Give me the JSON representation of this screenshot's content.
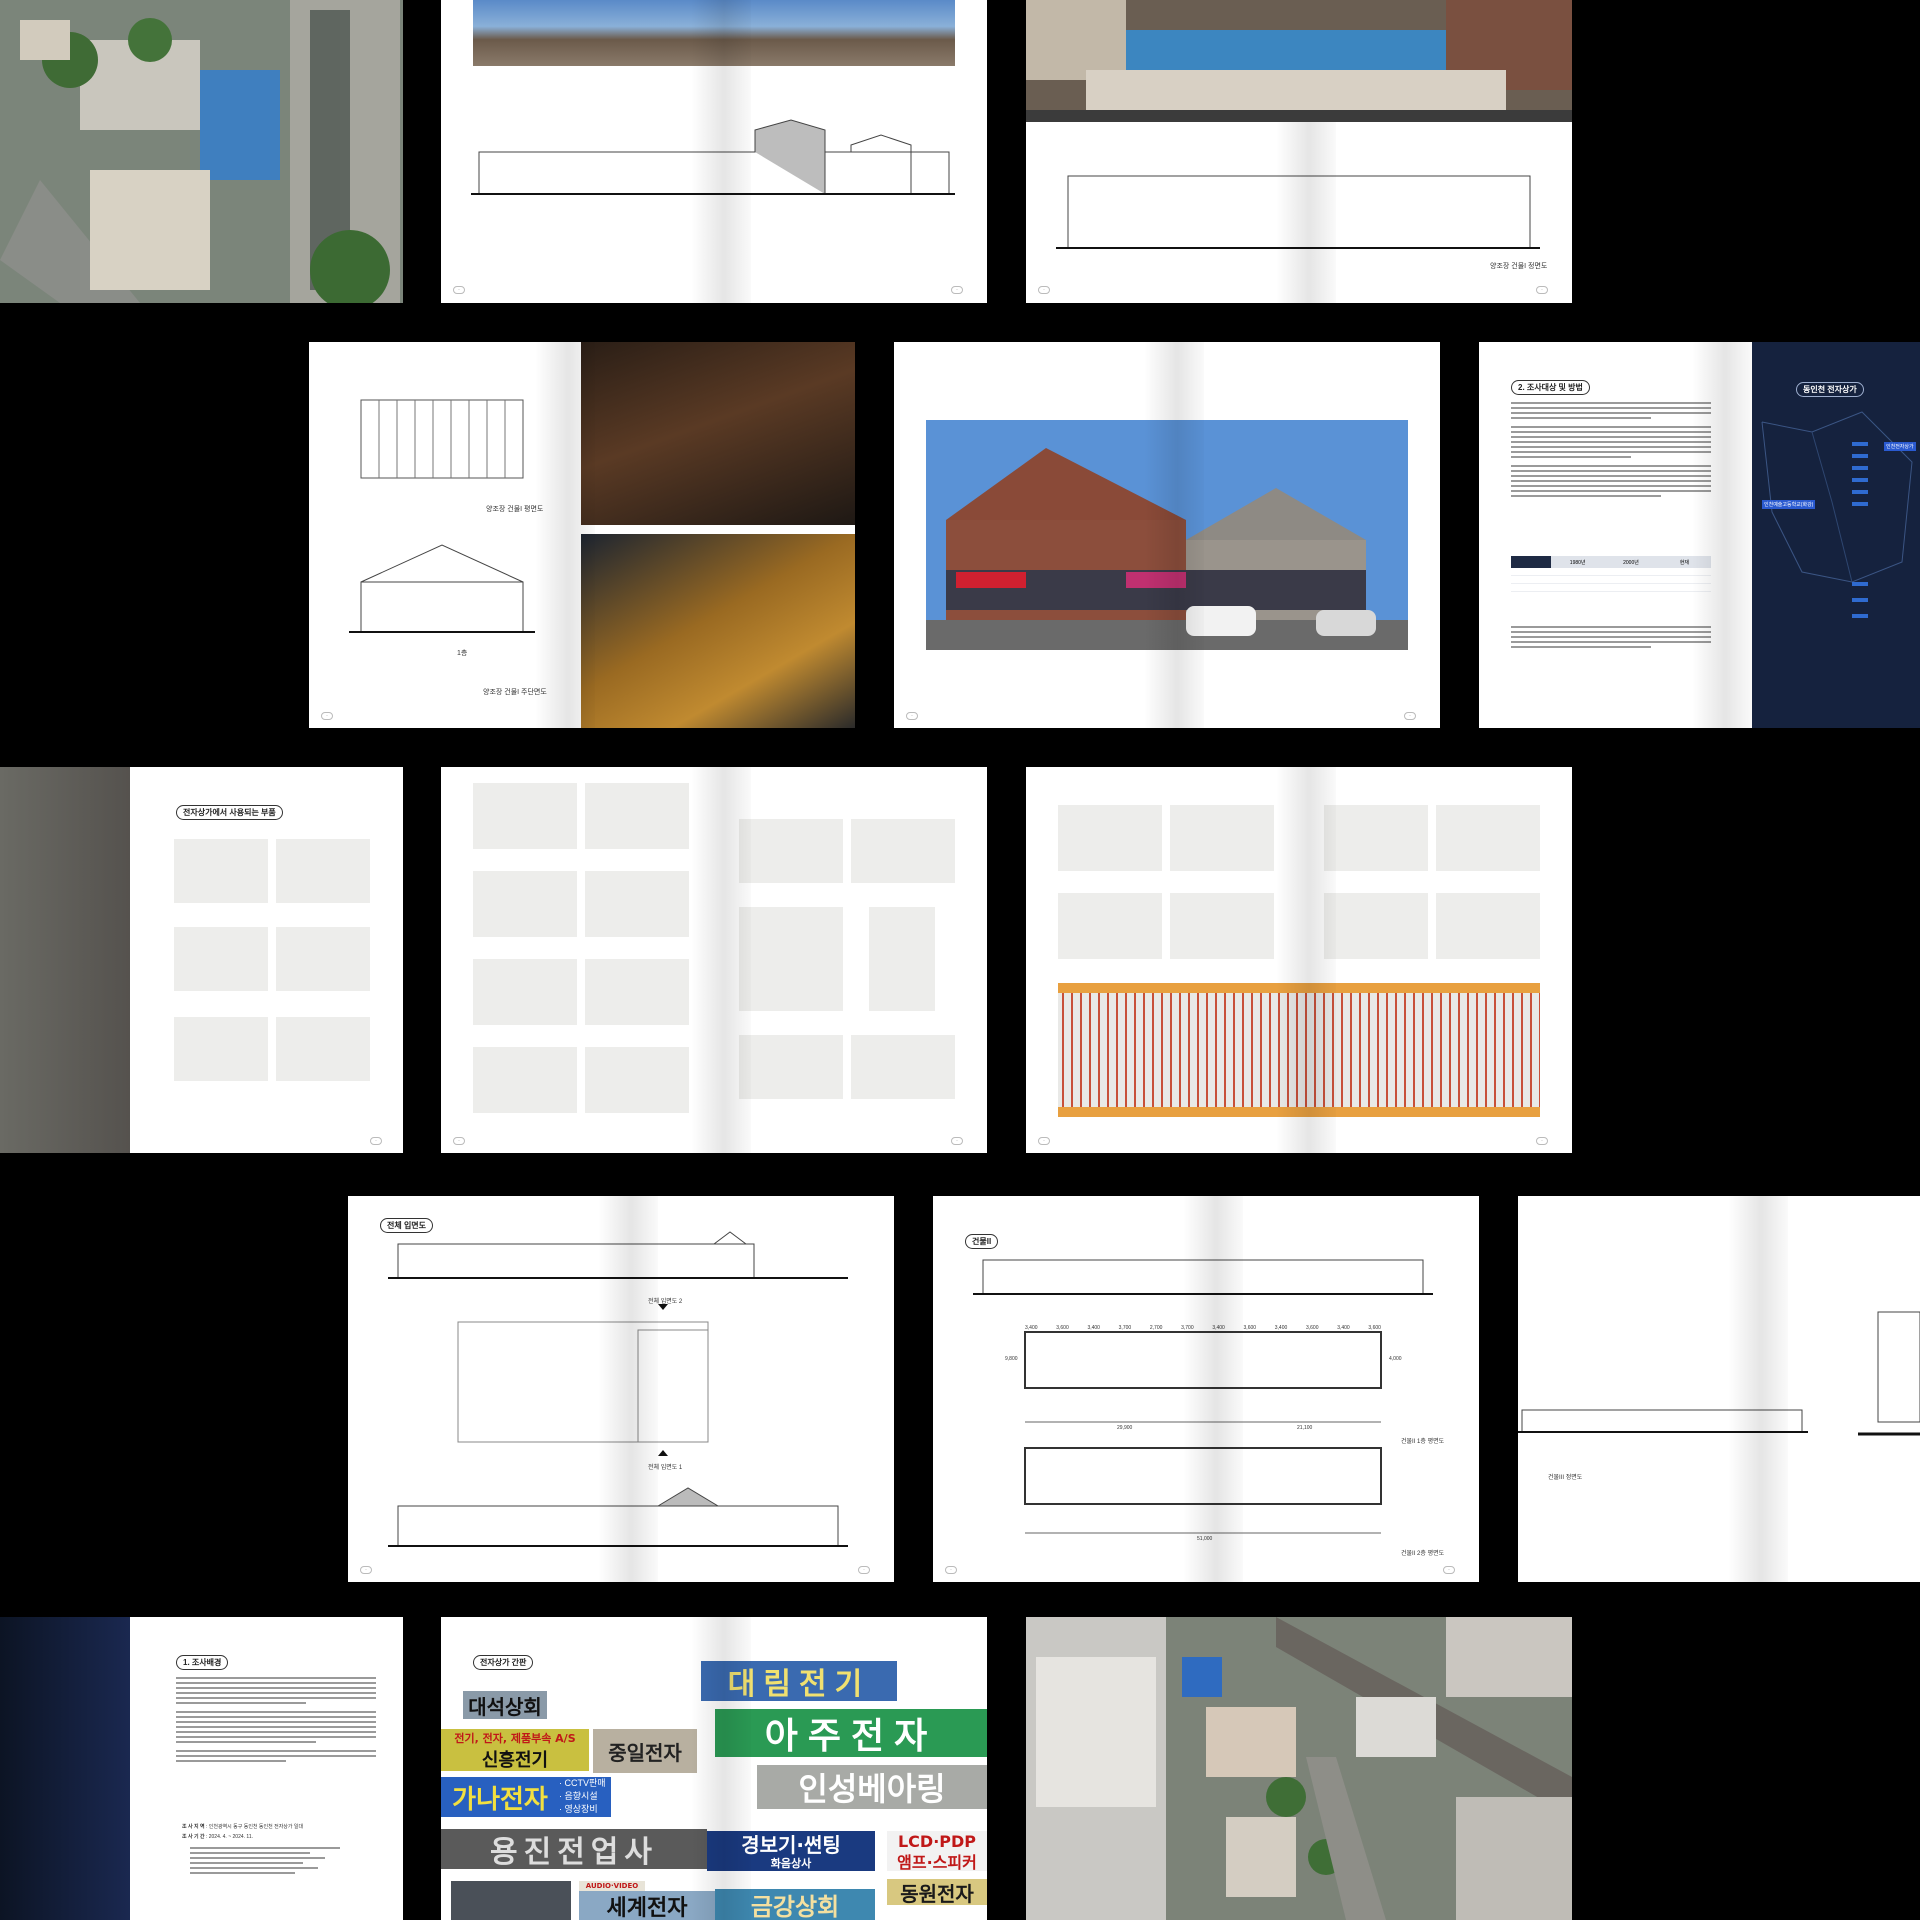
{
  "spreads": {
    "west_elevation": {
      "caption": "양조장 건물I 정면도"
    },
    "plan_section": {
      "roof_caption": "양조장 건물I 평면도",
      "section_caption": "양조장 건물I 주단면도",
      "section_label": "1층"
    },
    "survey": {
      "heading": "2. 조사대상 및 방법",
      "map_title": "동인천 전자상가",
      "map_label": "인천예술고등학교(화강)",
      "map_callout": "인천전자상가",
      "table_header": [
        "",
        "1980년",
        "2000년",
        "현재"
      ]
    },
    "parts": {
      "heading": "전자상가에서 사용되는 부품"
    },
    "full_elevation": {
      "heading": "전체 입면도",
      "label_top": "전체 입면도 2",
      "label_bottom": "전체 입면도 1"
    },
    "building2": {
      "heading": "건물II",
      "plan1_caption": "건물II 1층 평면도",
      "plan2_caption": "건물II 2층 평면도",
      "dims": [
        "3,400",
        "3,600",
        "3,400",
        "3,700",
        "2,700",
        "3,700",
        "3,400",
        "3,600",
        "3,400",
        "3,600",
        "3,400",
        "3,600"
      ],
      "total_left": "29,900",
      "total_right": "21,100",
      "total_all": "51,000",
      "height_left": "9,800",
      "height_right": "4,000"
    },
    "building_cut": {
      "caption": "건물III 정면도"
    },
    "intro": {
      "heading": "1. 조사배경",
      "meta_label_1": "조 사 지 역",
      "meta_value_1": "인천광역시 동구 동인천 동인천 전자상가 일대",
      "meta_label_2": "조 사 기 간",
      "meta_value_2": "2024. 4. ~ 2024. 11."
    },
    "signs": {
      "heading": "전자상가 간판",
      "items": [
        "대림전기",
        "대석상회",
        "아주전자",
        "전기, 전자, 제품부속 A/S",
        "신흥전기",
        "중일전자",
        "가나전자",
        "· CCTV판매",
        "· 음향시설",
        "· 영상장비",
        "인성베아링",
        "용진전업사",
        "경보기·썬팅",
        "화음상사",
        "LCD·PDP",
        "앰프·스피커",
        "동원전자",
        "세계전자",
        "AUDIO·VIDEO",
        "금강상회"
      ]
    }
  },
  "colors": {
    "background": "#000000",
    "page": "#ffffff",
    "navy": "#16223d",
    "sign_blue": "#2a5aa8",
    "sign_green": "#2a8a4a"
  }
}
